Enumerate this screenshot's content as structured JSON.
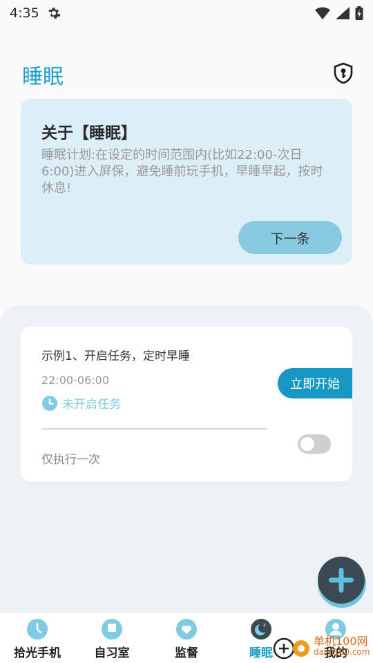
{
  "status_bar": {
    "time": "4:35",
    "icons": [
      "gear-icon",
      "wifi-icon",
      "signal-icon",
      "battery-icon"
    ]
  },
  "header": {
    "title": "睡眠",
    "right_icon": "shield-key-icon"
  },
  "about_card": {
    "title": "关于【睡眠】",
    "text": "睡眠计划:在设定的时间范围内(比如22:00-次日6:00)进入屏保，避免睡前玩手机，早睡早起，按时休息!",
    "next_label": "下一条"
  },
  "task": {
    "title": "示例1、开启任务，定时早睡",
    "time_range": "22:00-06:00",
    "status": "未开启任务",
    "start_label": "立即开始",
    "repeat_label": "仅执行一次",
    "toggle_on": false
  },
  "fab": {
    "icon": "plus-icon"
  },
  "bottom_nav": {
    "items": [
      {
        "label": "拾光手机",
        "icon": "clock-icon"
      },
      {
        "label": "自习室",
        "icon": "book-icon"
      },
      {
        "label": "监督",
        "icon": "heart-icon"
      },
      {
        "label": "睡眠",
        "icon": "moon-icon",
        "active": true
      },
      {
        "label": "我的",
        "icon": "person-icon"
      }
    ]
  },
  "watermark": {
    "text": "单机100网",
    "sub": "danji100.com"
  },
  "colors": {
    "accent": "#1e9ec9",
    "card_bg": "#dceef6",
    "button_light": "#88cbe1",
    "button_dark": "#1798c4",
    "fab_dark": "#3b4a52"
  }
}
